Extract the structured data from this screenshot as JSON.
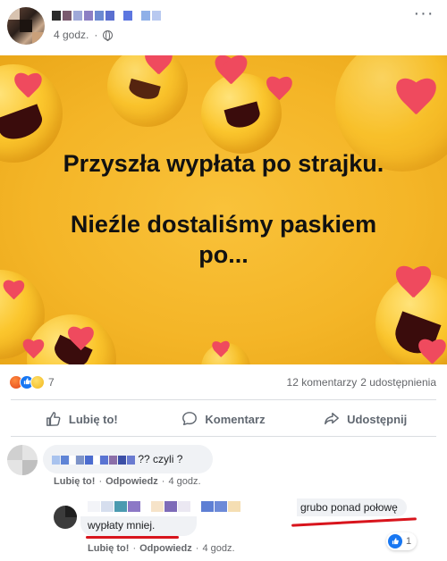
{
  "post": {
    "time": "4 godz.",
    "more_label": "···"
  },
  "image": {
    "line1": "Przyszła wypłata po strajku.",
    "line2": "Nieźle dostaliśmy paskiem",
    "line3": "po..."
  },
  "stats": {
    "reactions": [
      "angry",
      "like",
      "sad"
    ],
    "reaction_count": "7",
    "comments": "12 komentarzy",
    "shares": "2 udostępnienia"
  },
  "actions": {
    "like": "Lubię to!",
    "comment": "Komentarz",
    "share": "Udostępnij"
  },
  "comments": [
    {
      "text": "?? czyli ?",
      "like_link": "Lubię to!",
      "reply_link": "Odpowiedz",
      "time": "4 godz."
    },
    {
      "text_line1": "grubo ponad połowę",
      "text_line2": "wypłaty mniej.",
      "like_link": "Lubię to!",
      "reply_link": "Odpowiedz",
      "time": "4 godz.",
      "like_count": "1"
    }
  ],
  "colors": {
    "brand_blue": "#1877f2",
    "image_yellow": "#f4b527",
    "heart_red": "#ef4a5e",
    "annotation_red": "#d8141c"
  },
  "icons": [
    "globe-icon",
    "more-icon",
    "thumbs-up-icon",
    "comment-icon",
    "share-icon"
  ],
  "separator": "·"
}
